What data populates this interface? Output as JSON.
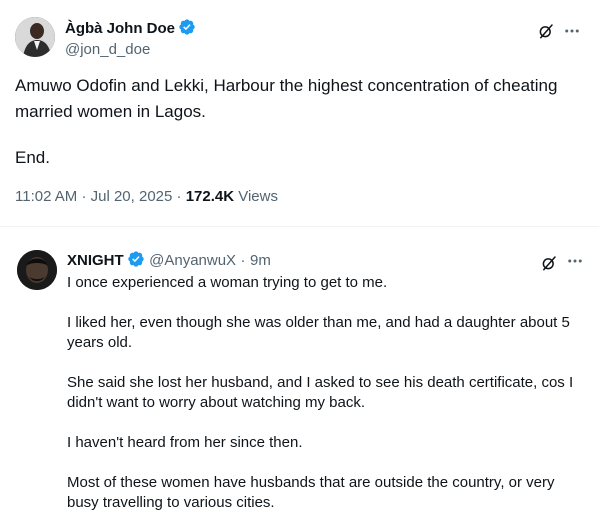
{
  "main_post": {
    "author_name": "Àgbà John Doe",
    "handle": "@jon_d_doe",
    "text": "Amuwo Odofin and Lekki, Harbour the highest concentration of cheating married women in Lagos.",
    "text2": "End.",
    "time": "11:02 AM",
    "date": "Jul 20, 2025",
    "views_count": "172.4K",
    "views_label": "Views",
    "separator": "·"
  },
  "reply": {
    "author_name": "XNIGHT",
    "handle": "@AnyanwuX",
    "age": "9m",
    "separator": "·",
    "paragraphs": [
      "I once experienced a woman trying to get to me.",
      "I liked her, even though she was older than me, and had a daughter about 5 years old.",
      "She said she lost her husband, and I asked to see his death certificate, cos I didn't want to worry about watching my back.",
      "I haven't heard from her since then.",
      "Most of these women have husbands that are outside the country, or very busy travelling to various cities."
    ]
  },
  "icons": {
    "verified": "verified-badge-icon",
    "grok": "grok-icon",
    "more": "more-icon"
  },
  "colors": {
    "verified": "#1d9bf0",
    "text": "#0f1419",
    "muted": "#536471"
  }
}
